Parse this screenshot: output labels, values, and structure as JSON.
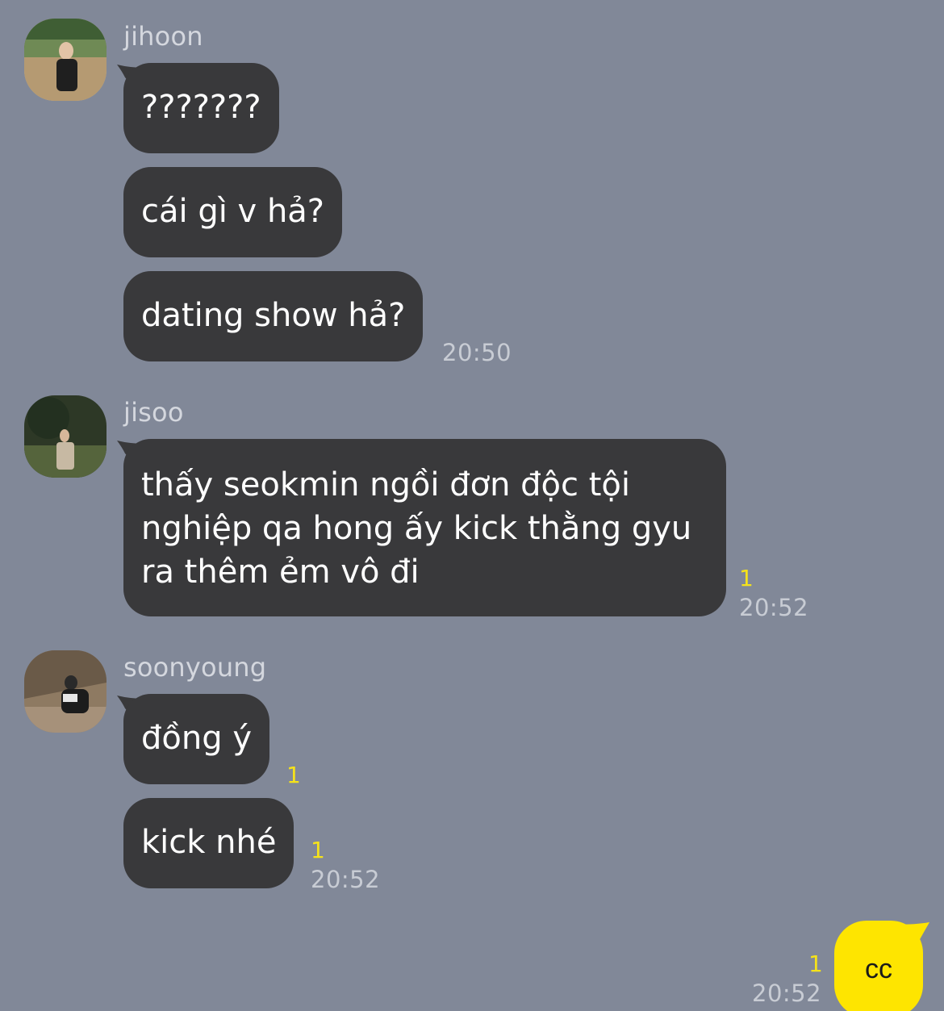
{
  "messages": {
    "jihoon": {
      "name": "jihoon",
      "bubbles": [
        "???????",
        "cái gì v hả?",
        "dating show hả?"
      ],
      "time": "20:50"
    },
    "jisoo": {
      "name": "jisoo",
      "bubble": "thấy seokmin ngồi đơn độc tội nghiệp qa hong ấy kick thằng gyu ra thêm ẻm vô đi",
      "unread": "1",
      "time": "20:52"
    },
    "soonyoung": {
      "name": "soonyoung",
      "bubbles": [
        "đồng ý",
        "kick nhé"
      ],
      "unread1": "1",
      "unread2": "1",
      "time": "20:52"
    },
    "me": {
      "bubble": "cc",
      "unread": "1",
      "time": "20:52"
    }
  },
  "colors": {
    "background": "#818898",
    "incoming_bubble": "#39393b",
    "outgoing_bubble": "#fee500",
    "unread": "#f5e21a"
  }
}
